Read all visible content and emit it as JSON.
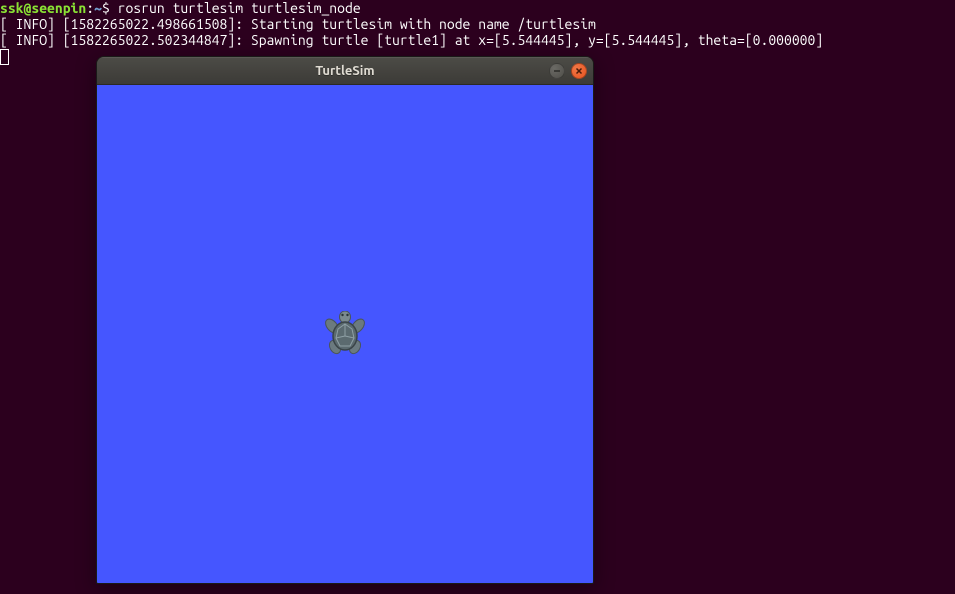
{
  "terminal": {
    "prompt_user": "ssk@seenpin",
    "prompt_sep1": ":",
    "prompt_path": "~",
    "prompt_sep2": "$ ",
    "command": "rosrun turtlesim turtlesim_node",
    "line1": "[ INFO] [1582265022.498661508]: Starting turtlesim with node name /turtlesim",
    "line2": "[ INFO] [1582265022.502344847]: Spawning turtle [turtle1] at x=[5.544445], y=[5.544445], theta=[0.000000]"
  },
  "window": {
    "title": "TurtleSim"
  }
}
